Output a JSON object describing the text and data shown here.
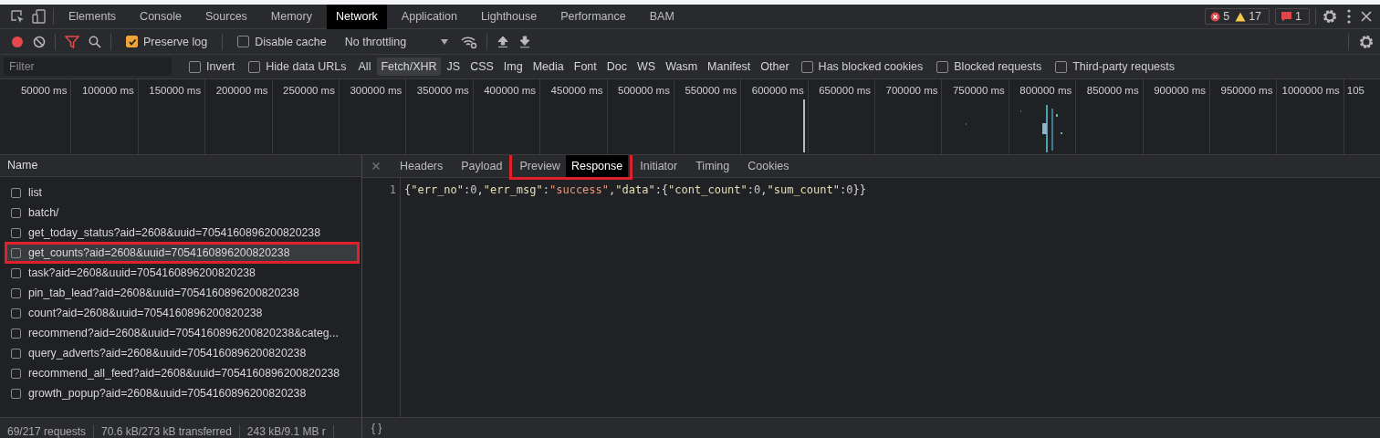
{
  "panel_tabs": [
    {
      "label": "Elements",
      "selected": false
    },
    {
      "label": "Console",
      "selected": false
    },
    {
      "label": "Sources",
      "selected": false
    },
    {
      "label": "Memory",
      "selected": false
    },
    {
      "label": "Network",
      "selected": true
    },
    {
      "label": "Application",
      "selected": false
    },
    {
      "label": "Lighthouse",
      "selected": false
    },
    {
      "label": "Performance",
      "selected": false
    },
    {
      "label": "BAM",
      "selected": false
    }
  ],
  "counters": {
    "errors": "5",
    "warnings": "17",
    "issues": "1"
  },
  "toolbar": {
    "recording": true,
    "preserve_log": {
      "label": "Preserve log",
      "checked": true
    },
    "disable_cache": {
      "label": "Disable cache",
      "checked": false
    },
    "throttling": "No throttling"
  },
  "filter": {
    "placeholder": "Filter",
    "invert": {
      "label": "Invert",
      "checked": false
    },
    "hide_data_urls": {
      "label": "Hide data URLs",
      "checked": false
    },
    "types": [
      {
        "label": "All",
        "selected": false
      },
      {
        "label": "Fetch/XHR",
        "selected": true
      },
      {
        "label": "JS",
        "selected": false
      },
      {
        "label": "CSS",
        "selected": false
      },
      {
        "label": "Img",
        "selected": false
      },
      {
        "label": "Media",
        "selected": false
      },
      {
        "label": "Font",
        "selected": false
      },
      {
        "label": "Doc",
        "selected": false
      },
      {
        "label": "WS",
        "selected": false
      },
      {
        "label": "Wasm",
        "selected": false
      },
      {
        "label": "Manifest",
        "selected": false
      },
      {
        "label": "Other",
        "selected": false
      }
    ],
    "options": [
      {
        "label": "Has blocked cookies",
        "checked": false
      },
      {
        "label": "Blocked requests",
        "checked": false
      },
      {
        "label": "Third-party requests",
        "checked": false
      }
    ]
  },
  "timeline": {
    "ticks": [
      "50000 ms",
      "100000 ms",
      "150000 ms",
      "200000 ms",
      "250000 ms",
      "300000 ms",
      "350000 ms",
      "400000 ms",
      "450000 ms",
      "500000 ms",
      "550000 ms",
      "600000 ms",
      "650000 ms",
      "700000 ms",
      "750000 ms",
      "800000 ms",
      "850000 ms",
      "900000 ms",
      "950000 ms",
      "1000000 ms",
      "105"
    ]
  },
  "requests": {
    "column": "Name",
    "rows": [
      {
        "name": "list",
        "selected": false,
        "annotated": false
      },
      {
        "name": "batch/",
        "selected": false,
        "annotated": false
      },
      {
        "name": "get_today_status?aid=2608&uuid=7054160896200820238",
        "selected": false,
        "annotated": false
      },
      {
        "name": "get_counts?aid=2608&uuid=7054160896200820238",
        "selected": true,
        "annotated": true
      },
      {
        "name": "task?aid=2608&uuid=7054160896200820238",
        "selected": false,
        "annotated": false
      },
      {
        "name": "pin_tab_lead?aid=2608&uuid=7054160896200820238",
        "selected": false,
        "annotated": false
      },
      {
        "name": "count?aid=2608&uuid=7054160896200820238",
        "selected": false,
        "annotated": false
      },
      {
        "name": "recommend?aid=2608&uuid=7054160896200820238&categ...",
        "selected": false,
        "annotated": false
      },
      {
        "name": "query_adverts?aid=2608&uuid=7054160896200820238",
        "selected": false,
        "annotated": false
      },
      {
        "name": "recommend_all_feed?aid=2608&uuid=7054160896200820238",
        "selected": false,
        "annotated": false
      },
      {
        "name": "growth_popup?aid=2608&uuid=7054160896200820238",
        "selected": false,
        "annotated": false
      }
    ]
  },
  "detail_tabs": [
    {
      "label": "Headers",
      "selected": false,
      "annotated": false
    },
    {
      "label": "Payload",
      "selected": false,
      "annotated": false
    },
    {
      "label": "Preview",
      "selected": false,
      "annotated": true
    },
    {
      "label": "Response",
      "selected": true,
      "annotated": true
    },
    {
      "label": "Initiator",
      "selected": false,
      "annotated": false
    },
    {
      "label": "Timing",
      "selected": false,
      "annotated": false
    },
    {
      "label": "Cookies",
      "selected": false,
      "annotated": false
    }
  ],
  "response": {
    "lines": [
      {
        "number": "1",
        "tokens": [
          {
            "kind": "punct",
            "text": "{"
          },
          {
            "kind": "key",
            "text": "\"err_no\""
          },
          {
            "kind": "punct",
            "text": ":"
          },
          {
            "kind": "number",
            "text": "0"
          },
          {
            "kind": "punct",
            "text": ","
          },
          {
            "kind": "key",
            "text": "\"err_msg\""
          },
          {
            "kind": "punct",
            "text": ":"
          },
          {
            "kind": "string",
            "text": "\"success\""
          },
          {
            "kind": "punct",
            "text": ","
          },
          {
            "kind": "key",
            "text": "\"data\""
          },
          {
            "kind": "punct",
            "text": ":{"
          },
          {
            "kind": "key",
            "text": "\"cont_count\""
          },
          {
            "kind": "punct",
            "text": ":"
          },
          {
            "kind": "number",
            "text": "0"
          },
          {
            "kind": "punct",
            "text": ","
          },
          {
            "kind": "key",
            "text": "\"sum_count\""
          },
          {
            "kind": "punct",
            "text": ":"
          },
          {
            "kind": "number",
            "text": "0"
          },
          {
            "kind": "punct",
            "text": "}}"
          }
        ]
      }
    ]
  },
  "status_bar": {
    "requests": "69/217 requests",
    "transferred": "70.6 kB/273 kB transferred",
    "resources": "243 kB/9.1 MB r",
    "format_button": "{ }"
  }
}
